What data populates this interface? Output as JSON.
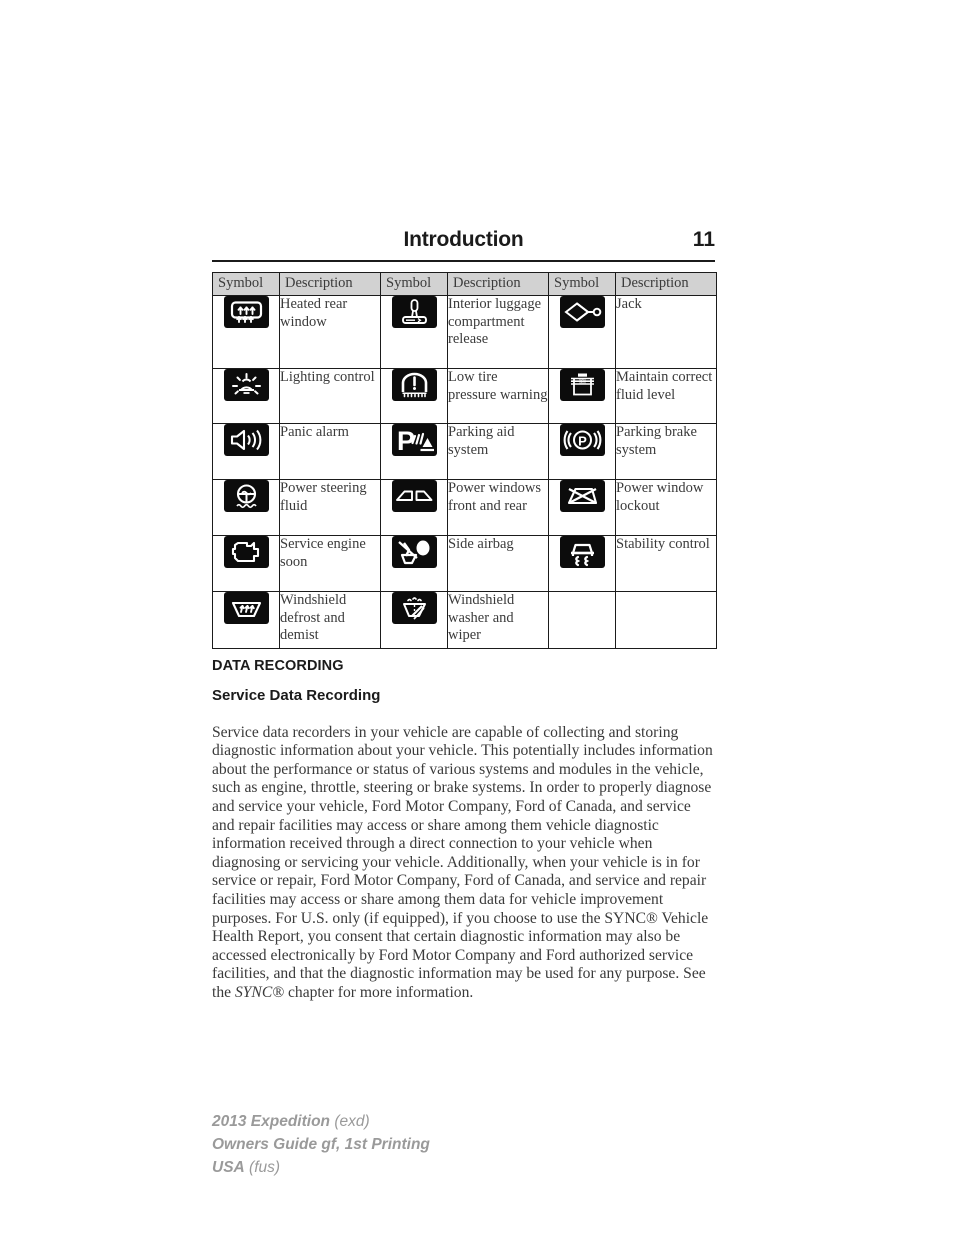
{
  "header": {
    "title": "Introduction",
    "page_number": "11"
  },
  "symbol_table": {
    "columns": [
      "Symbol",
      "Description",
      "Symbol",
      "Description",
      "Symbol",
      "Description"
    ],
    "rows": [
      [
        {
          "icon": "heated-rear-window-icon",
          "label": "Heated rear window"
        },
        {
          "icon": "interior-luggage-compartment-release-icon",
          "label": "Interior luggage compartment release"
        },
        {
          "icon": "jack-icon",
          "label": "Jack"
        }
      ],
      [
        {
          "icon": "lighting-control-icon",
          "label": "Lighting control"
        },
        {
          "icon": "low-tire-pressure-warning-icon",
          "label": "Low tire pressure warning"
        },
        {
          "icon": "maintain-correct-fluid-level-icon",
          "label": "Maintain correct fluid level"
        }
      ],
      [
        {
          "icon": "panic-alarm-icon",
          "label": "Panic alarm"
        },
        {
          "icon": "parking-aid-system-icon",
          "label": "Parking aid system"
        },
        {
          "icon": "parking-brake-system-icon",
          "label": "Parking brake system"
        }
      ],
      [
        {
          "icon": "power-steering-fluid-icon",
          "label": "Power steering fluid"
        },
        {
          "icon": "power-windows-front-and-rear-icon",
          "label": "Power windows front and rear"
        },
        {
          "icon": "power-window-lockout-icon",
          "label": "Power window lockout"
        }
      ],
      [
        {
          "icon": "service-engine-soon-icon",
          "label": "Service engine soon"
        },
        {
          "icon": "side-airbag-icon",
          "label": "Side airbag"
        },
        {
          "icon": "stability-control-icon",
          "label": "Stability control"
        }
      ],
      [
        {
          "icon": "windshield-defrost-and-demist-icon",
          "label": "Windshield defrost and demist"
        },
        {
          "icon": "windshield-washer-and-wiper-icon",
          "label": "Windshield washer and wiper"
        },
        {
          "icon": "",
          "label": ""
        }
      ]
    ]
  },
  "sections": {
    "data_recording_heading": "DATA RECORDING",
    "service_data_recording_heading": "Service Data Recording"
  },
  "body": {
    "paragraph_1_part_a": "Service data recorders in your vehicle are capable of collecting and storing diagnostic information about your vehicle. This potentially includes information about the performance or status of various systems and modules in the vehicle, such as engine, throttle, steering or brake systems. In order to properly diagnose and service your vehicle, Ford Motor Company, Ford of Canada, and service and repair facilities may access or share among them vehicle diagnostic information received through a direct connection to your vehicle when diagnosing or servicing your vehicle. Additionally, when your vehicle is in for service or repair, Ford Motor Company, Ford of Canada, and service and repair facilities may access or share among them data for vehicle improvement purposes. For U.S. only (if equipped), if you choose to use the SYNC® Vehicle Health Report, you consent that certain diagnostic information may also be accessed electronically by Ford Motor Company and Ford authorized service facilities, and that the diagnostic information may be used for any purpose. See the ",
    "paragraph_1_italic": "SYNC®",
    "paragraph_1_part_b": " chapter for more information."
  },
  "footer": {
    "line1_bold": "2013 Expedition",
    "line1_light": "(exd)",
    "line2_bold": "Owners Guide gf, 1st Printing",
    "line3_bold": "USA",
    "line3_light": "(fus)"
  },
  "colors": {
    "icon_tile": "#0c0c0c",
    "table_header_bg": "#d2d2d2",
    "text": "#3a3a3a",
    "footer_text": "#9a9a9a"
  }
}
